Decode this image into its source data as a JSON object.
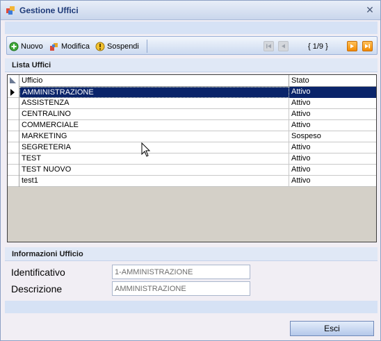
{
  "window": {
    "title": "Gestione Uffici",
    "close_icon": "close-icon"
  },
  "toolbar": {
    "new_label": "Nuovo",
    "edit_label": "Modifica",
    "suspend_label": "Sospendi",
    "pager_text": "{ 1/9 }"
  },
  "list_section": {
    "title": "Lista Uffici",
    "columns": [
      "Ufficio",
      "Stato"
    ],
    "rows": [
      {
        "ufficio": "AMMINISTRAZIONE",
        "stato": "Attivo"
      },
      {
        "ufficio": "ASSISTENZA",
        "stato": "Attivo"
      },
      {
        "ufficio": "CENTRALINO",
        "stato": "Attivo"
      },
      {
        "ufficio": "COMMERCIALE",
        "stato": "Attivo"
      },
      {
        "ufficio": "MARKETING",
        "stato": "Sospeso"
      },
      {
        "ufficio": "SEGRETERIA",
        "stato": "Attivo"
      },
      {
        "ufficio": "TEST",
        "stato": "Attivo"
      },
      {
        "ufficio": "TEST NUOVO",
        "stato": "Attivo"
      },
      {
        "ufficio": "test1",
        "stato": "Attivo"
      }
    ],
    "selected_index": 0
  },
  "info_section": {
    "title": "Informazioni Ufficio",
    "identificativo_label": "Identificativo",
    "identificativo_value": "1-AMMINISTRAZIONE",
    "descrizione_label": "Descrizione",
    "descrizione_value": "AMMINISTRAZIONE"
  },
  "footer": {
    "exit_label": "Esci"
  },
  "colors": {
    "selection": "#0A246A",
    "band": "#D6E2F5",
    "nav_active": "#F28A00"
  }
}
